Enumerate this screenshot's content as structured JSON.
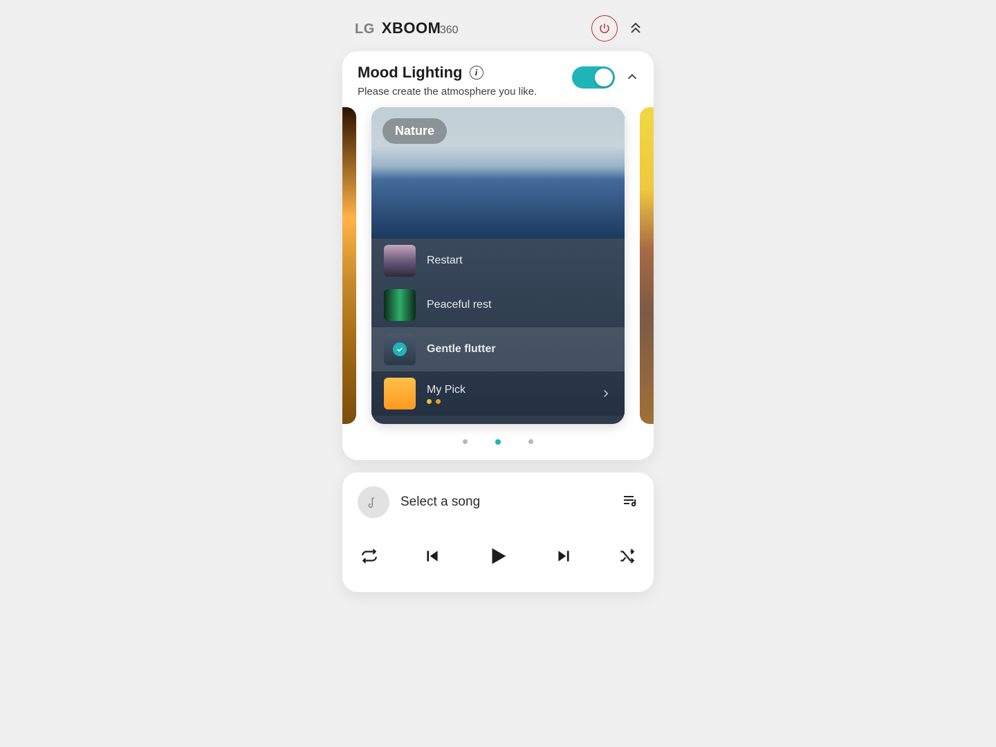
{
  "appbar": {
    "brand_lg": "LG",
    "brand_main": "XBOOM",
    "brand_sub": "360"
  },
  "mood": {
    "title": "Mood Lighting",
    "subtitle": "Please create the atmosphere you like.",
    "toggle_on": true,
    "current_category": "Nature",
    "presets": [
      {
        "label": "Restart",
        "selected": false
      },
      {
        "label": "Peaceful rest",
        "selected": false
      },
      {
        "label": "Gentle flutter",
        "selected": true
      },
      {
        "label": "My Pick",
        "selected": false,
        "has_more": true
      }
    ],
    "pager": {
      "count": 3,
      "active": 1
    }
  },
  "player": {
    "now_title": "Select a song"
  }
}
